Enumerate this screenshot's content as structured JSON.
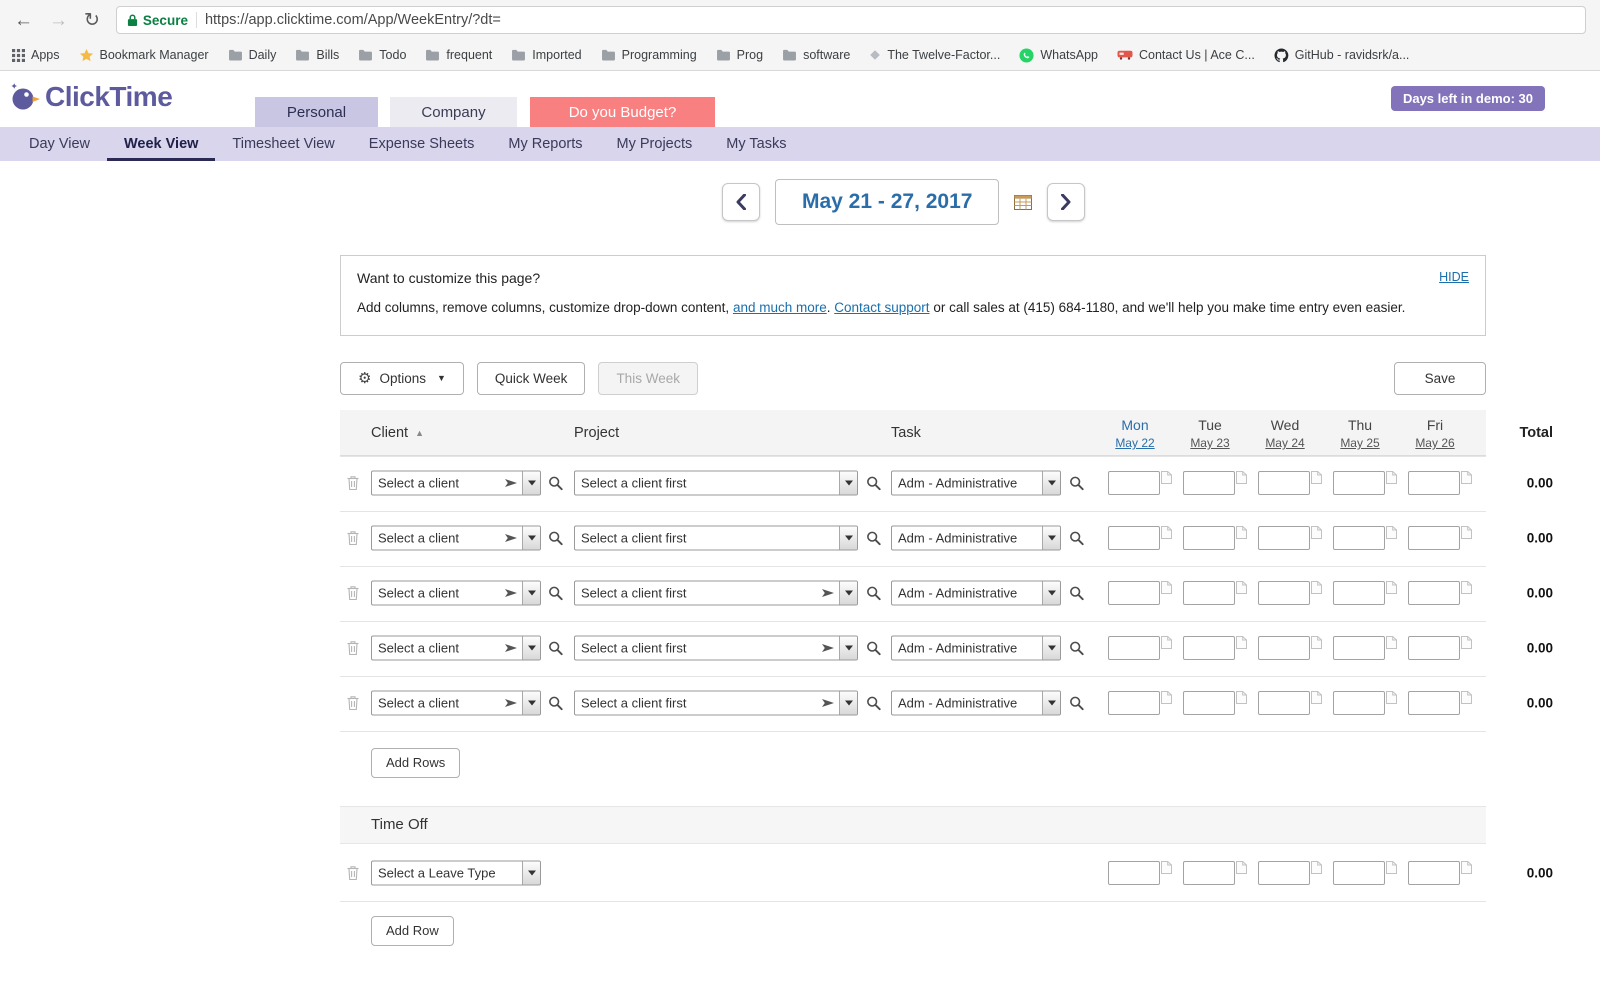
{
  "icons": {
    "back": "←",
    "forward": "→",
    "reload": "↻",
    "gear": "⚙",
    "caret_down": "▼",
    "sort_asc": "▲"
  },
  "browser": {
    "secure_label": "Secure",
    "url": "https://app.clicktime.com/App/WeekEntry/?dt=",
    "bookmarks": [
      {
        "icon": "apps-grid-icon",
        "label": "Apps"
      },
      {
        "icon": "star-icon",
        "label": "Bookmark Manager"
      },
      {
        "icon": "folder-icon",
        "label": "Daily"
      },
      {
        "icon": "folder-icon",
        "label": "Bills"
      },
      {
        "icon": "folder-icon",
        "label": "Todo"
      },
      {
        "icon": "folder-icon",
        "label": "frequent"
      },
      {
        "icon": "folder-icon",
        "label": "Imported"
      },
      {
        "icon": "folder-icon",
        "label": "Programming"
      },
      {
        "icon": "folder-icon",
        "label": "Prog"
      },
      {
        "icon": "folder-icon",
        "label": "software"
      },
      {
        "icon": "diamond-icon",
        "label": "The Twelve-Factor..."
      },
      {
        "icon": "whatsapp-icon",
        "label": "WhatsApp"
      },
      {
        "icon": "contact-icon",
        "label": "Contact Us | Ace C..."
      },
      {
        "icon": "github-icon",
        "label": "GitHub - ravidsrk/a..."
      }
    ]
  },
  "header": {
    "logo_text": "ClickTime",
    "tabs": {
      "personal": "Personal",
      "company": "Company",
      "budget": "Do you Budget?"
    },
    "demo_badge": "Days left in demo: 30"
  },
  "nav": {
    "items": [
      {
        "label": "Day View"
      },
      {
        "label": "Week View",
        "active": true
      },
      {
        "label": "Timesheet View"
      },
      {
        "label": "Expense Sheets"
      },
      {
        "label": "My Reports"
      },
      {
        "label": "My Projects"
      },
      {
        "label": "My Tasks"
      }
    ]
  },
  "week_nav": {
    "date_range": "May 21 - 27, 2017"
  },
  "notice": {
    "title": "Want to customize this page?",
    "body_pre": "Add columns, remove columns, customize drop-down content, ",
    "link_more": "and much more",
    "body_dot": ". ",
    "link_support": "Contact support",
    "body_post": " or call sales at (415) 684-1180, and we'll help you make time entry even easier.",
    "hide_link": "HIDE"
  },
  "toolbar": {
    "options": "Options",
    "quick_week": "Quick Week",
    "this_week": "This Week",
    "save": "Save"
  },
  "table": {
    "headers": {
      "client": "Client",
      "project": "Project",
      "task": "Task",
      "total": "Total"
    },
    "days": [
      {
        "name": "Mon",
        "date": "May 22",
        "today": true
      },
      {
        "name": "Tue",
        "date": "May 23"
      },
      {
        "name": "Wed",
        "date": "May 24"
      },
      {
        "name": "Thu",
        "date": "May 25"
      },
      {
        "name": "Fri",
        "date": "May 26"
      }
    ],
    "rows": [
      {
        "client": "Select a client",
        "client_filter": true,
        "project": "Select a client first",
        "project_filter": false,
        "task": "Adm - Administrative",
        "total": "0.00"
      },
      {
        "client": "Select a client",
        "client_filter": true,
        "project": "Select a client first",
        "project_filter": false,
        "task": "Adm - Administrative",
        "total": "0.00"
      },
      {
        "client": "Select a client",
        "client_filter": true,
        "project": "Select a client first",
        "project_filter": true,
        "task": "Adm - Administrative",
        "total": "0.00"
      },
      {
        "client": "Select a client",
        "client_filter": true,
        "project": "Select a client first",
        "project_filter": true,
        "task": "Adm - Administrative",
        "total": "0.00"
      },
      {
        "client": "Select a client",
        "client_filter": true,
        "project": "Select a client first",
        "project_filter": true,
        "task": "Adm - Administrative",
        "total": "0.00"
      }
    ],
    "add_rows_label": "Add Rows"
  },
  "time_off": {
    "title": "Time Off",
    "leave_select": "Select a Leave Type",
    "total": "0.00",
    "add_row_label": "Add Row"
  }
}
